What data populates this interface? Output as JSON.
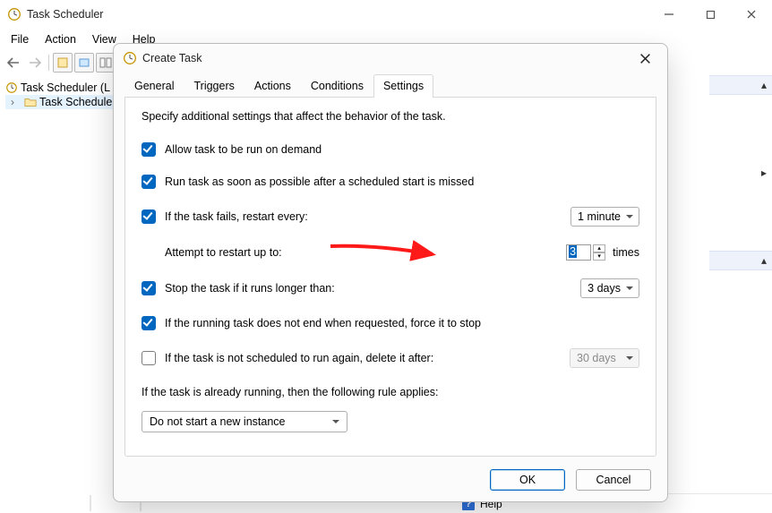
{
  "window": {
    "title": "Task Scheduler",
    "menus": {
      "file": "File",
      "action": "Action",
      "view": "View",
      "help": "Help"
    }
  },
  "tree": {
    "root": "Task Scheduler (L",
    "child": "Task Schedule"
  },
  "dialog": {
    "title": "Create Task",
    "tabs": {
      "general": "General",
      "triggers": "Triggers",
      "actions": "Actions",
      "conditions": "Conditions",
      "settings": "Settings"
    },
    "caption": "Specify additional settings that affect the behavior of the task.",
    "settings": {
      "allow_demand": "Allow task to be run on demand",
      "run_asap": "Run task as soon as possible after a scheduled start is missed",
      "restart_every": "If the task fails, restart every:",
      "restart_interval": "1 minute",
      "attempt_upto": "Attempt to restart up to:",
      "attempt_value": "3",
      "attempt_suffix": "times",
      "stop_longer": "Stop the task if it runs longer than:",
      "stop_longer_val": "3 days",
      "force_stop": "If the running task does not end when requested, force it to stop",
      "delete_after": "If the task is not scheduled to run again, delete it after:",
      "delete_after_val": "30 days",
      "rule_label": "If the task is already running, then the following rule applies:",
      "rule_value": "Do not start a new instance"
    },
    "buttons": {
      "ok": "OK",
      "cancel": "Cancel"
    }
  },
  "help_label": "Help"
}
